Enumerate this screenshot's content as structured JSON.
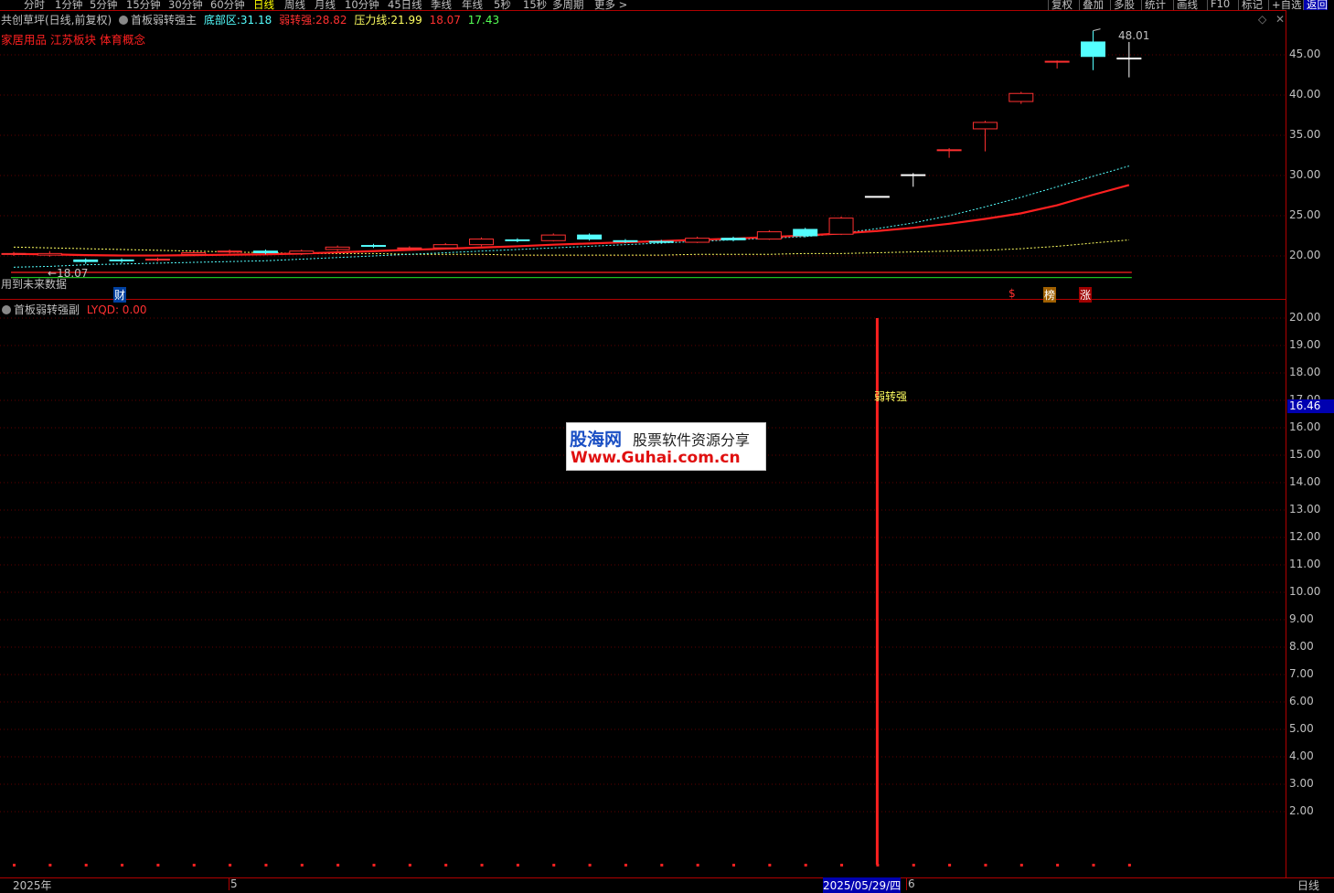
{
  "toolbar": {
    "periods": [
      {
        "label": "分时",
        "x": 26
      },
      {
        "label": "1分钟",
        "x": 60
      },
      {
        "label": "5分钟",
        "x": 98
      },
      {
        "label": "15分钟",
        "x": 138
      },
      {
        "label": "30分钟",
        "x": 184
      },
      {
        "label": "60分钟",
        "x": 230
      },
      {
        "label": "日线",
        "x": 277
      },
      {
        "label": "周线",
        "x": 311
      },
      {
        "label": "月线",
        "x": 344
      },
      {
        "label": "10分钟",
        "x": 377
      },
      {
        "label": "45日线",
        "x": 424
      },
      {
        "label": "季线",
        "x": 471
      },
      {
        "label": "年线",
        "x": 505
      },
      {
        "label": "5秒",
        "x": 540
      },
      {
        "label": "15秒",
        "x": 572
      },
      {
        "label": "多周期",
        "x": 604
      },
      {
        "label": "更多 >",
        "x": 650
      }
    ],
    "active_period": "日线",
    "right_buttons": [
      {
        "label": "复权",
        "x": 1146
      },
      {
        "label": "叠加",
        "x": 1180
      },
      {
        "label": "多股",
        "x": 1214
      },
      {
        "label": "统计",
        "x": 1248
      },
      {
        "label": "画线",
        "x": 1283
      },
      {
        "label": "F10",
        "x": 1320
      },
      {
        "label": "标记",
        "x": 1354
      },
      {
        "label": "+自选",
        "x": 1387
      },
      {
        "label": "返回",
        "x": 1425
      }
    ]
  },
  "main": {
    "stock_title": "共创草坪(日线,前复权)",
    "indicator_name": "首板弱转强主",
    "bottom_zone_label": "底部区:",
    "bottom_zone_value": "31.18",
    "weak_strong_label": "弱转强:",
    "weak_strong_value": "28.82",
    "pressure_label": "压力线:",
    "pressure_value": "21.99",
    "extra_value_1": "18.07",
    "extra_value_2": "17.43",
    "sectors": "家居用品 江苏板块 体育概念",
    "max_marker": "48.01",
    "min_marker": "18.07",
    "future_data_note": "用到未来数据",
    "marker_cai": "财",
    "marker_dollar": "$",
    "marker_bang": "榜",
    "marker_zhang": "涨"
  },
  "sub": {
    "indicator_name": "首板弱转强副",
    "lyqd_label": "LYQD: 0.00",
    "signal_label": "弱转强"
  },
  "axis_upper": [
    "45.00",
    "40.00",
    "35.00",
    "30.00",
    "25.00",
    "20.00"
  ],
  "axis_lower": [
    "20.00",
    "19.00",
    "18.00",
    "17.00",
    "16.00",
    "15.00",
    "14.00",
    "13.00",
    "12.00",
    "11.00",
    "10.00",
    "9.00",
    "8.00",
    "7.00",
    "6.00",
    "5.00",
    "4.00",
    "3.00",
    "2.00"
  ],
  "crosshair_value": "16.46",
  "dates": {
    "year": "2025年",
    "month5": "5",
    "selected": "2025/05/29/四",
    "month6": "6"
  },
  "period_label": "日线",
  "watermark": {
    "line1a": "股海网",
    "line1b": "股票软件资源分享",
    "line2": "Www.Guhai.com.cn"
  },
  "colors": {
    "up": "#ff3030",
    "down": "#54ffff",
    "ma_red": "#ff2020",
    "ma_cyan": "#54ffff",
    "ma_yellow": "#ffff60",
    "border": "#b00000"
  },
  "chart_data": {
    "type": "candlestick",
    "ylim": [
      17,
      49
    ],
    "candles": [
      {
        "o": 20.2,
        "c": 20.3,
        "h": 20.5,
        "l": 20.0
      },
      {
        "o": 20.1,
        "c": 20.3,
        "h": 20.6,
        "l": 19.9
      },
      {
        "o": 19.5,
        "c": 19.3,
        "h": 19.7,
        "l": 19.0
      },
      {
        "o": 19.5,
        "c": 19.4,
        "h": 19.7,
        "l": 19.1
      },
      {
        "o": 19.5,
        "c": 19.6,
        "h": 19.8,
        "l": 19.3
      },
      {
        "o": 20.2,
        "c": 20.4,
        "h": 20.6,
        "l": 20.0
      },
      {
        "o": 20.5,
        "c": 20.6,
        "h": 20.8,
        "l": 20.3
      },
      {
        "o": 20.6,
        "c": 20.4,
        "h": 20.8,
        "l": 20.2
      },
      {
        "o": 20.3,
        "c": 20.6,
        "h": 20.8,
        "l": 20.1
      },
      {
        "o": 20.8,
        "c": 21.1,
        "h": 21.3,
        "l": 20.6
      },
      {
        "o": 21.3,
        "c": 21.2,
        "h": 21.5,
        "l": 21.0
      },
      {
        "o": 20.9,
        "c": 21.0,
        "h": 21.2,
        "l": 20.7
      },
      {
        "o": 21.0,
        "c": 21.4,
        "h": 21.6,
        "l": 20.9
      },
      {
        "o": 21.4,
        "c": 22.1,
        "h": 22.3,
        "l": 21.2
      },
      {
        "o": 22.0,
        "c": 21.9,
        "h": 22.2,
        "l": 21.7
      },
      {
        "o": 21.9,
        "c": 22.6,
        "h": 22.8,
        "l": 21.8
      },
      {
        "o": 22.6,
        "c": 22.1,
        "h": 22.8,
        "l": 21.9
      },
      {
        "o": 21.9,
        "c": 21.8,
        "h": 22.1,
        "l": 21.6
      },
      {
        "o": 21.8,
        "c": 21.7,
        "h": 22.0,
        "l": 21.5
      },
      {
        "o": 21.7,
        "c": 22.2,
        "h": 22.4,
        "l": 21.6
      },
      {
        "o": 22.2,
        "c": 22.0,
        "h": 22.4,
        "l": 21.8
      },
      {
        "o": 22.1,
        "c": 23.0,
        "h": 23.2,
        "l": 22.0
      },
      {
        "o": 23.3,
        "c": 22.5,
        "h": 23.5,
        "l": 22.3
      },
      {
        "o": 22.7,
        "c": 24.7,
        "h": 24.9,
        "l": 22.6
      },
      {
        "o": 27.4,
        "c": 27.4,
        "h": 27.4,
        "l": 27.4
      },
      {
        "o": 30.1,
        "c": 30.1,
        "h": 30.3,
        "l": 28.6
      },
      {
        "o": 33.1,
        "c": 33.2,
        "h": 33.4,
        "l": 32.2
      },
      {
        "o": 35.8,
        "c": 36.6,
        "h": 36.8,
        "l": 33.0
      },
      {
        "o": 39.2,
        "c": 40.2,
        "h": 40.4,
        "l": 38.9
      },
      {
        "o": 44.1,
        "c": 44.2,
        "h": 44.3,
        "l": 43.3
      },
      {
        "o": 46.6,
        "c": 44.8,
        "h": 48.0,
        "l": 43.1
      },
      {
        "o": 44.6,
        "c": 44.6,
        "h": 46.6,
        "l": 42.2
      }
    ],
    "ma_red": [
      20.25,
      20.2,
      20.1,
      20.05,
      20.05,
      20.1,
      20.15,
      20.2,
      20.3,
      20.45,
      20.6,
      20.75,
      20.9,
      21.05,
      21.2,
      21.4,
      21.55,
      21.7,
      21.85,
      22.0,
      22.15,
      22.35,
      22.55,
      22.8,
      23.1,
      23.5,
      24.0,
      24.6,
      25.3,
      26.3,
      27.6,
      28.82
    ],
    "ma_cyan": [
      18.6,
      18.7,
      18.9,
      19.0,
      19.1,
      19.2,
      19.3,
      19.4,
      19.6,
      19.8,
      20.0,
      20.2,
      20.4,
      20.6,
      20.8,
      21.0,
      21.2,
      21.4,
      21.6,
      21.8,
      22.0,
      22.2,
      22.4,
      22.8,
      23.4,
      24.1,
      25.0,
      26.1,
      27.3,
      28.6,
      29.9,
      31.18
    ],
    "ma_yellow": [
      21.1,
      21.0,
      20.9,
      20.8,
      20.7,
      20.6,
      20.5,
      20.4,
      20.3,
      20.3,
      20.3,
      20.2,
      20.2,
      20.2,
      20.1,
      20.1,
      20.1,
      20.1,
      20.1,
      20.2,
      20.2,
      20.2,
      20.3,
      20.3,
      20.4,
      20.5,
      20.6,
      20.7,
      20.9,
      21.2,
      21.6,
      21.99
    ],
    "support_red": 18.07,
    "support_green": 17.43,
    "signal_index": 24,
    "signal_value": 20
  }
}
